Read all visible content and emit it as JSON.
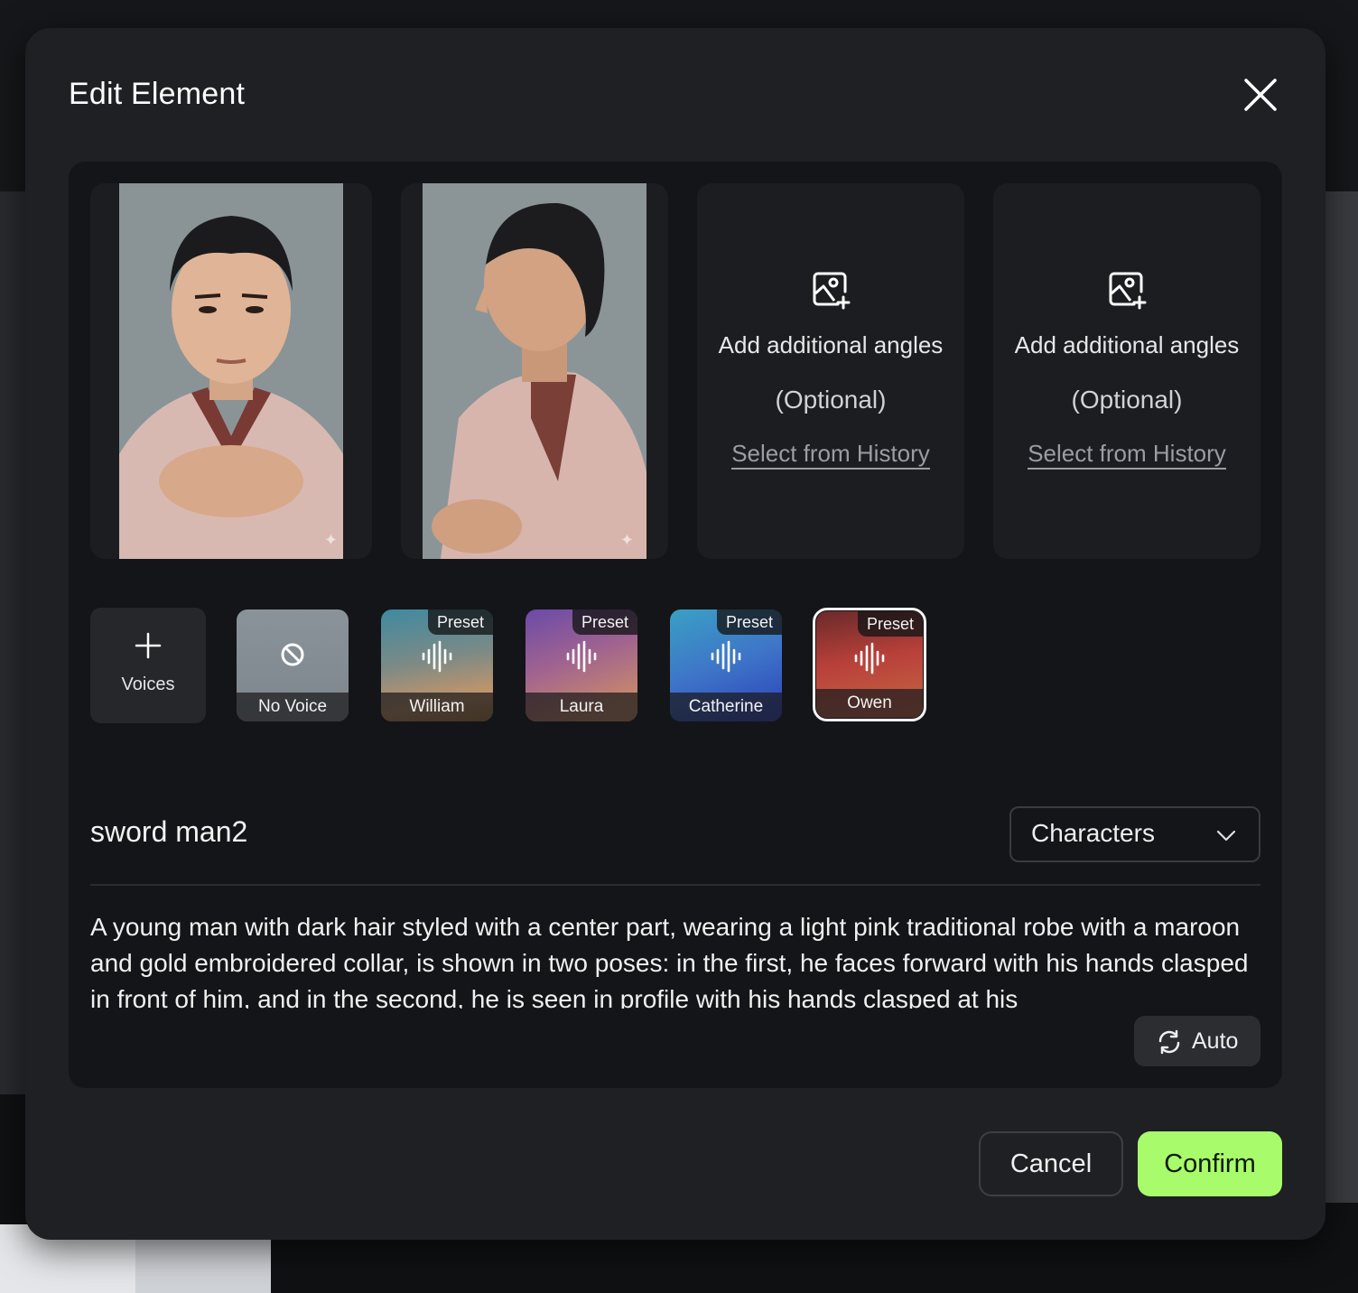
{
  "dialog": {
    "title": "Edit Element",
    "close_icon": "close-icon"
  },
  "images": [
    {
      "kind": "portrait-front",
      "corner_icon": "sparkle-icon"
    },
    {
      "kind": "portrait-profile",
      "corner_icon": "sparkle-icon"
    }
  ],
  "angle_slots": [
    {
      "line1": "Add additional angles",
      "line2": "(Optional)",
      "link": "Select from History",
      "icon": "add-image-icon"
    },
    {
      "line1": "Add additional angles",
      "line2": "(Optional)",
      "link": "Select from History",
      "icon": "add-image-icon"
    }
  ],
  "voices": {
    "add_label": "Voices",
    "items": [
      {
        "name": "No Voice",
        "badge": "",
        "icon": "no-voice-icon",
        "selected": false
      },
      {
        "name": "William",
        "badge": "Preset",
        "icon": "waveform-icon",
        "selected": false
      },
      {
        "name": "Laura",
        "badge": "Preset",
        "icon": "waveform-icon",
        "selected": false
      },
      {
        "name": "Catherine",
        "badge": "Preset",
        "icon": "waveform-icon",
        "selected": false
      },
      {
        "name": "Owen",
        "badge": "Preset",
        "icon": "waveform-icon",
        "selected": true
      }
    ]
  },
  "element": {
    "name": "sword man2",
    "category": "Characters",
    "description": "A young man with dark hair styled with a center part, wearing a light pink traditional robe with a maroon and gold embroidered collar, is shown in two poses: in the first, he faces forward with his hands clasped in front of him, and in the second, he is seen in profile with his hands clasped at his",
    "auto_label": "Auto"
  },
  "footer": {
    "cancel_label": "Cancel",
    "confirm_label": "Confirm"
  },
  "colors": {
    "accent": "#a8fb6b",
    "modal_bg": "#1f2023",
    "panel_bg": "#141518"
  }
}
